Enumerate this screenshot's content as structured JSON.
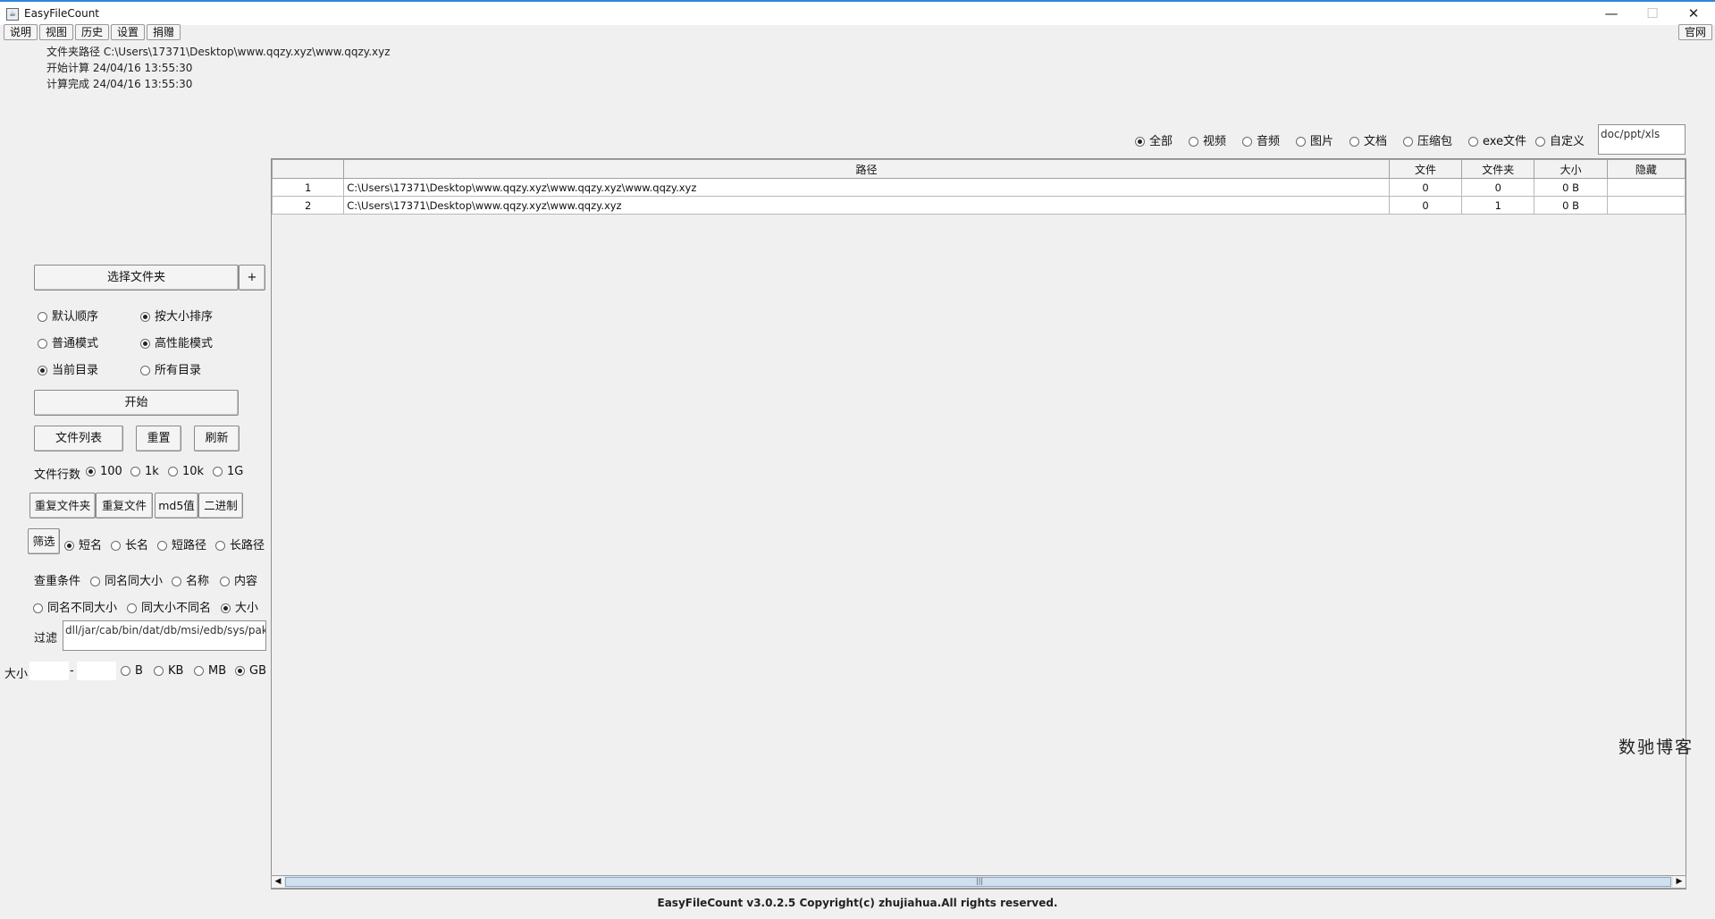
{
  "window": {
    "title": "EasyFileCount",
    "minimize_glyph": "—",
    "maximize_glyph": "☐",
    "close_glyph": "✕",
    "app_icon": "java-app-icon"
  },
  "menu": [
    "说明",
    "视图",
    "历史",
    "设置",
    "捐赠"
  ],
  "official_button": "官网",
  "info": {
    "folder_path": "文件夹路径 C:\\Users\\17371\\Desktop\\www.qqzy.xyz\\www.qqzy.xyz",
    "start_time": "开始计算 24/04/16 13:55:30",
    "end_time": "计算完成 24/04/16 13:55:30"
  },
  "type_filters": {
    "options": [
      "全部",
      "视频",
      "音频",
      "图片",
      "文档",
      "压缩包",
      "exe文件",
      "自定义"
    ],
    "selected": "全部",
    "custom_value": "doc/ppt/xls"
  },
  "table": {
    "columns": [
      "",
      "路径",
      "文件",
      "文件夹",
      "大小",
      "隐藏"
    ],
    "rows": [
      [
        "1",
        "C:\\Users\\17371\\Desktop\\www.qqzy.xyz\\www.qqzy.xyz\\www.qqzy.xyz",
        "0",
        "0",
        "0 B",
        ""
      ],
      [
        "2",
        "C:\\Users\\17371\\Desktop\\www.qqzy.xyz\\www.qqzy.xyz",
        "0",
        "1",
        "0 B",
        ""
      ]
    ]
  },
  "left": {
    "select_folder": "选择文件夹",
    "plus": "+",
    "sort_default": "默认顺序",
    "sort_size": "按大小排序",
    "mode_normal": "普通模式",
    "mode_high": "高性能模式",
    "dir_current": "当前目录",
    "dir_all": "所有目录",
    "start": "开始",
    "file_list": "文件列表",
    "reset": "重置",
    "refresh": "刷新",
    "rows_label": "文件行数",
    "rows_options": [
      "100",
      "1k",
      "10k",
      "1G"
    ],
    "dup_folder": "重复文件夹",
    "dup_file": "重复文件",
    "md5": "md5值",
    "binary": "二进制",
    "filter_btn": "筛选",
    "name_options": [
      "短名",
      "长名",
      "短路径",
      "长路径"
    ],
    "dup_cond_label": "查重条件",
    "dup_cond_1": [
      "同名同大小",
      "名称",
      "内容"
    ],
    "dup_cond_2": [
      "同名不同大小",
      "同大小不同名",
      "大小"
    ],
    "filter_label": "过滤",
    "filter_value": "dll/jar/cab/bin/dat/db/msi/edb/sys/pak/jsa",
    "size_label": "大小",
    "size_sep": "-",
    "size_units": [
      "B",
      "KB",
      "MB",
      "GB"
    ]
  },
  "footer": "EasyFileCount v3.0.2.5 Copyright(c) zhujiahua.All rights reserved.",
  "watermark": "数驰博客"
}
